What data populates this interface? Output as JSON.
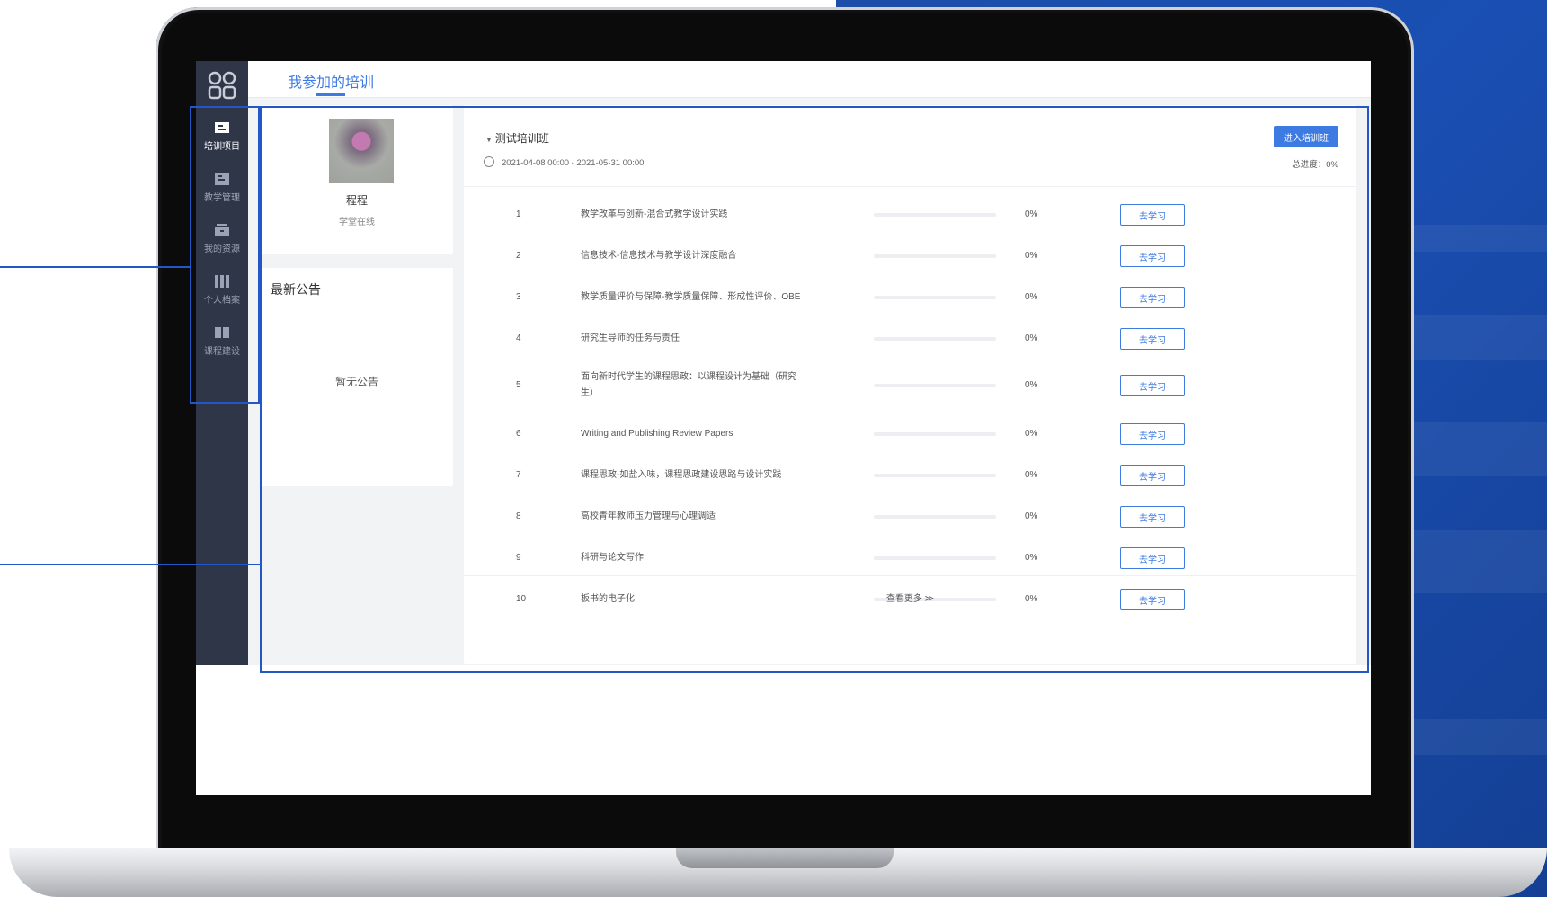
{
  "sidebar": {
    "items": [
      {
        "label": "培训项目",
        "icon": "training-icon",
        "active": true
      },
      {
        "label": "教学管理",
        "icon": "teaching-icon",
        "active": false
      },
      {
        "label": "我的资源",
        "icon": "resource-icon",
        "active": false
      },
      {
        "label": "个人档案",
        "icon": "profile-icon",
        "active": false
      },
      {
        "label": "课程建设",
        "icon": "course-icon",
        "active": false
      }
    ]
  },
  "header": {
    "tab": "我参加的培训"
  },
  "profile": {
    "name": "程程",
    "org": "学堂在线"
  },
  "notice": {
    "title": "最新公告",
    "empty": "暂无公告"
  },
  "program": {
    "name": "测试培训班",
    "date": "2021-04-08 00:00 - 2021-05-31 00:00",
    "enter_label": "进入培训班",
    "progress_label": "总进度：",
    "progress_value": "0%"
  },
  "courses": [
    {
      "index": "1",
      "title": "教学改革与创新-混合式教学设计实践",
      "progress": "0%",
      "action": "去学习"
    },
    {
      "index": "2",
      "title": "信息技术-信息技术与教学设计深度融合",
      "progress": "0%",
      "action": "去学习"
    },
    {
      "index": "3",
      "title": "教学质量评价与保障-教学质量保障、形成性评价、OBE",
      "progress": "0%",
      "action": "去学习"
    },
    {
      "index": "4",
      "title": "研究生导师的任务与责任",
      "progress": "0%",
      "action": "去学习"
    },
    {
      "index": "5",
      "title": "面向新时代学生的课程思政：以课程设计为基础（研究生）",
      "progress": "0%",
      "action": "去学习"
    },
    {
      "index": "6",
      "title": "Writing and Publishing Review Papers",
      "progress": "0%",
      "action": "去学习"
    },
    {
      "index": "7",
      "title": "课程思政-如盐入味，课程思政建设思路与设计实践",
      "progress": "0%",
      "action": "去学习"
    },
    {
      "index": "8",
      "title": "高校青年教师压力管理与心理调适",
      "progress": "0%",
      "action": "去学习"
    },
    {
      "index": "9",
      "title": "科研与论文写作",
      "progress": "0%",
      "action": "去学习"
    },
    {
      "index": "10",
      "title": "板书的电子化",
      "progress": "0%",
      "action": "去学习"
    }
  ],
  "view_more": "查看更多 ≫",
  "colors": {
    "accent": "#3d7be3",
    "sidebar": "#2f3647",
    "frame": "#2357c8"
  }
}
